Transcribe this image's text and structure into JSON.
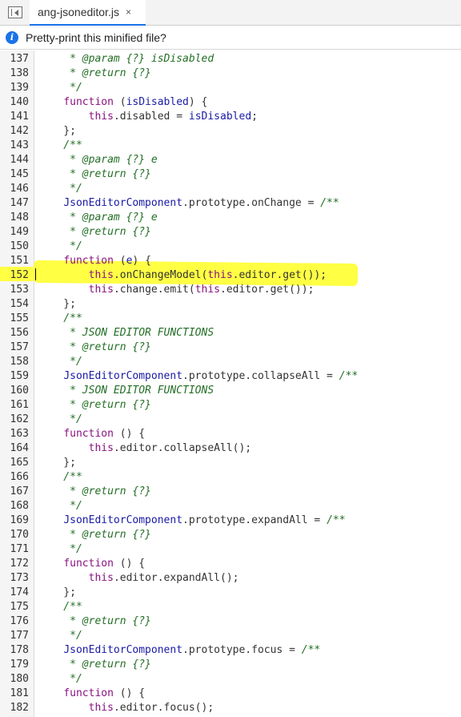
{
  "tab": {
    "title": "ang-jsoneditor.js",
    "close": "×"
  },
  "infobar": {
    "icon": "i",
    "message": "Pretty-print this minified file?"
  },
  "editor": {
    "highlight_color": "#ffff44",
    "lines": [
      {
        "num": "137",
        "code": "     * @param {?} isDisabled"
      },
      {
        "num": "138",
        "code": "     * @return {?}"
      },
      {
        "num": "139",
        "code": "     */"
      },
      {
        "num": "140",
        "code": "    function (isDisabled) {"
      },
      {
        "num": "141",
        "code": "        this.disabled = isDisabled;"
      },
      {
        "num": "142",
        "code": "    };"
      },
      {
        "num": "143",
        "code": "    /**"
      },
      {
        "num": "144",
        "code": "     * @param {?} e"
      },
      {
        "num": "145",
        "code": "     * @return {?}"
      },
      {
        "num": "146",
        "code": "     */"
      },
      {
        "num": "147",
        "code": "    JsonEditorComponent.prototype.onChange = /**"
      },
      {
        "num": "148",
        "code": "     * @param {?} e"
      },
      {
        "num": "149",
        "code": "     * @return {?}"
      },
      {
        "num": "150",
        "code": "     */"
      },
      {
        "num": "151",
        "code": "    function (e) {"
      },
      {
        "num": "152",
        "code": "        this.onChangeModel(this.editor.get());"
      },
      {
        "num": "153",
        "code": "        this.change.emit(this.editor.get());"
      },
      {
        "num": "154",
        "code": "    };"
      },
      {
        "num": "155",
        "code": "    /**"
      },
      {
        "num": "156",
        "code": "     * JSON EDITOR FUNCTIONS"
      },
      {
        "num": "157",
        "code": "     * @return {?}"
      },
      {
        "num": "158",
        "code": "     */"
      },
      {
        "num": "159",
        "code": "    JsonEditorComponent.prototype.collapseAll = /**"
      },
      {
        "num": "160",
        "code": "     * JSON EDITOR FUNCTIONS"
      },
      {
        "num": "161",
        "code": "     * @return {?}"
      },
      {
        "num": "162",
        "code": "     */"
      },
      {
        "num": "163",
        "code": "    function () {"
      },
      {
        "num": "164",
        "code": "        this.editor.collapseAll();"
      },
      {
        "num": "165",
        "code": "    };"
      },
      {
        "num": "166",
        "code": "    /**"
      },
      {
        "num": "167",
        "code": "     * @return {?}"
      },
      {
        "num": "168",
        "code": "     */"
      },
      {
        "num": "169",
        "code": "    JsonEditorComponent.prototype.expandAll = /**"
      },
      {
        "num": "170",
        "code": "     * @return {?}"
      },
      {
        "num": "171",
        "code": "     */"
      },
      {
        "num": "172",
        "code": "    function () {"
      },
      {
        "num": "173",
        "code": "        this.editor.expandAll();"
      },
      {
        "num": "174",
        "code": "    };"
      },
      {
        "num": "175",
        "code": "    /**"
      },
      {
        "num": "176",
        "code": "     * @return {?}"
      },
      {
        "num": "177",
        "code": "     */"
      },
      {
        "num": "178",
        "code": "    JsonEditorComponent.prototype.focus = /**"
      },
      {
        "num": "179",
        "code": "     * @return {?}"
      },
      {
        "num": "180",
        "code": "     */"
      },
      {
        "num": "181",
        "code": "    function () {"
      },
      {
        "num": "182",
        "code": "        this.editor.focus();"
      }
    ]
  }
}
